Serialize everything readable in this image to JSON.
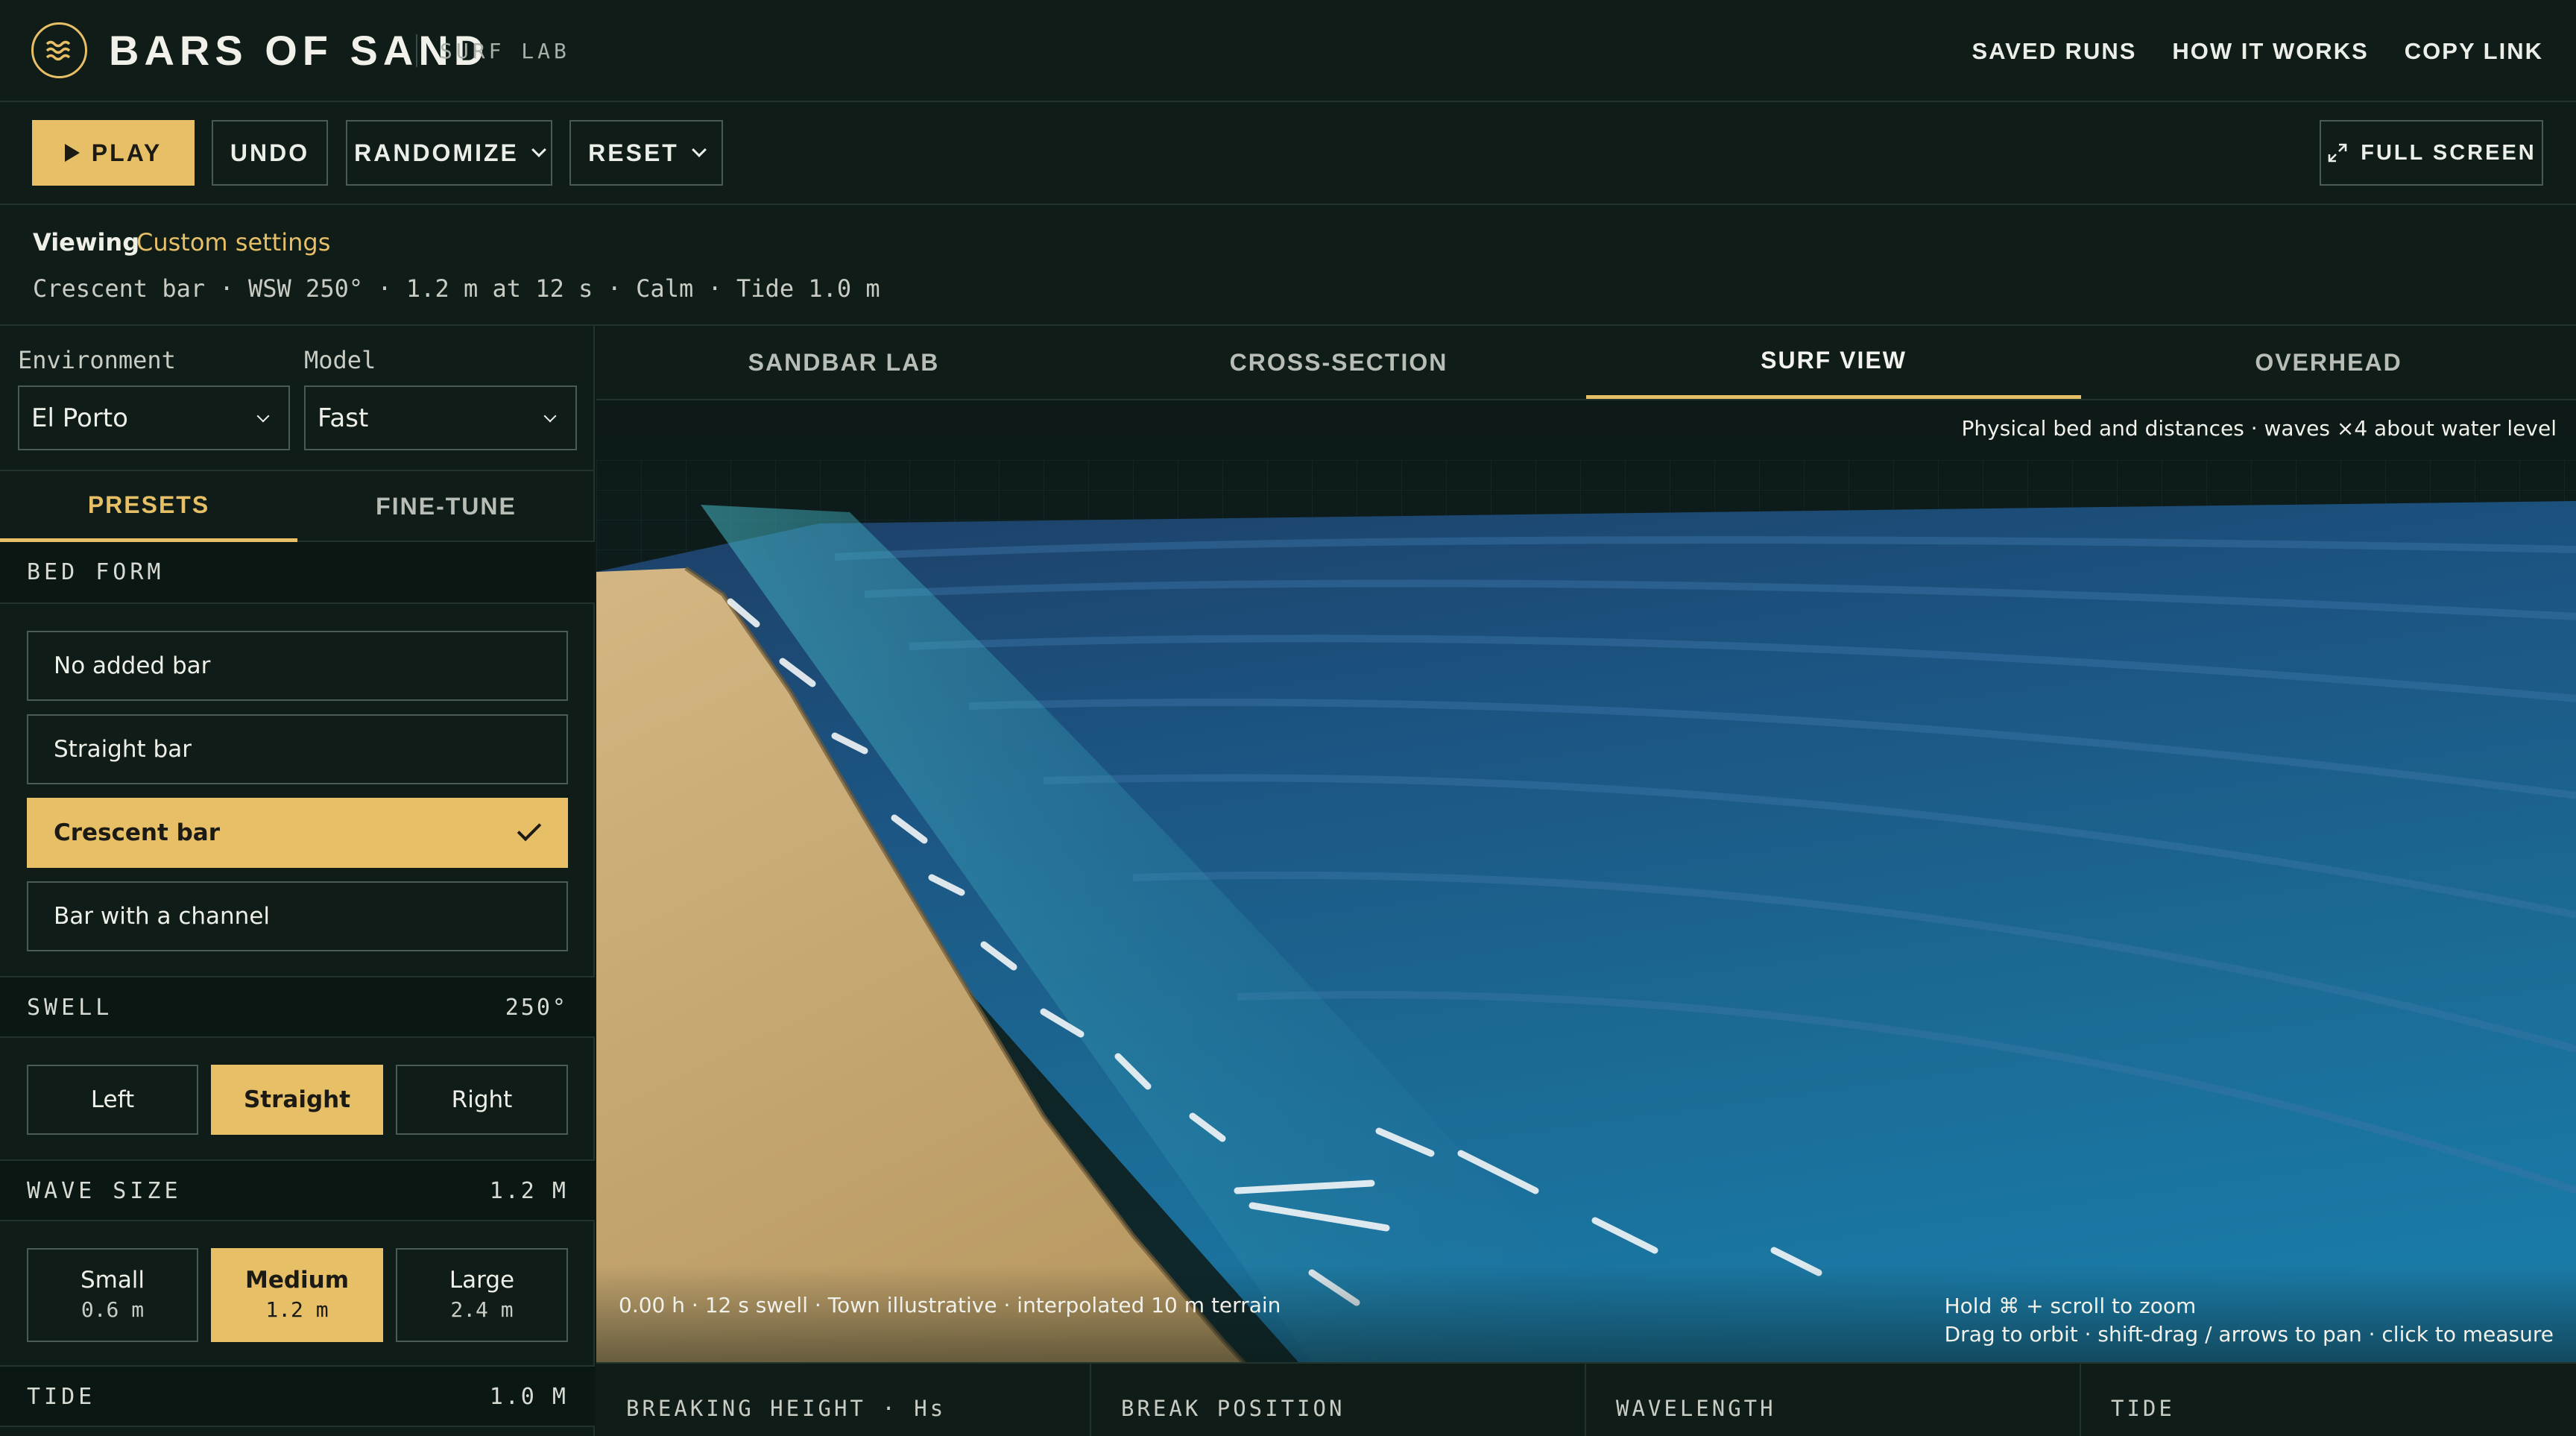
{
  "brand": {
    "name": "BARS OF SAND",
    "sub": "SURF LAB"
  },
  "nav": [
    "SAVED RUNS",
    "HOW IT WORKS",
    "COPY LINK"
  ],
  "toolbar": {
    "play": "PLAY",
    "undo": "UNDO",
    "randomize": "RANDOMIZE",
    "reset": "RESET",
    "fullscreen": "FULL SCREEN"
  },
  "viewing": {
    "label": "Viewing",
    "value": "Custom settings",
    "summary": "Crescent bar · WSW 250° · 1.2 m at 12 s · Calm · Tide 1.0 m"
  },
  "sidebar": {
    "environment_label": "Environment",
    "environment_value": "El Porto",
    "model_label": "Model",
    "model_value": "Fast",
    "tabs": [
      "PRESETS",
      "FINE-TUNE"
    ],
    "bed_form": {
      "title": "BED FORM",
      "options": [
        "No added bar",
        "Straight bar",
        "Crescent bar",
        "Bar with a channel"
      ],
      "selected": "Crescent bar"
    },
    "swell": {
      "title": "SWELL",
      "value": "250°",
      "options": [
        "Left",
        "Straight",
        "Right"
      ],
      "selected": "Straight"
    },
    "wave_size": {
      "title": "WAVE SIZE",
      "value": "1.2 M",
      "options": [
        {
          "label": "Small",
          "sub": "0.6 m"
        },
        {
          "label": "Medium",
          "sub": "1.2 m"
        },
        {
          "label": "Large",
          "sub": "2.4 m"
        }
      ],
      "selected": "Medium"
    },
    "tide": {
      "title": "TIDE",
      "value": "1.0 M"
    }
  },
  "view_tabs": [
    "SANDBAR LAB",
    "CROSS-SECTION",
    "SURF VIEW",
    "OVERHEAD"
  ],
  "active_view": "SURF VIEW",
  "scene": {
    "note": "Physical bed and distances · waves ×4 about water level",
    "status": "0.00 h · 12 s swell · Town illustrative · interpolated 10 m terrain",
    "hint_line1": "Hold ⌘ + scroll to zoom",
    "hint_line2": "Drag to orbit · shift-drag / arrows to pan · click to measure"
  },
  "metrics": [
    "BREAKING HEIGHT · Hs",
    "BREAK POSITION",
    "WAVELENGTH",
    "TIDE"
  ],
  "colors": {
    "background": "#0f1c18",
    "accent": "#e6bf66",
    "border": "#4a5a54",
    "sand": "#c9ad78",
    "water": "#1f6f98"
  }
}
